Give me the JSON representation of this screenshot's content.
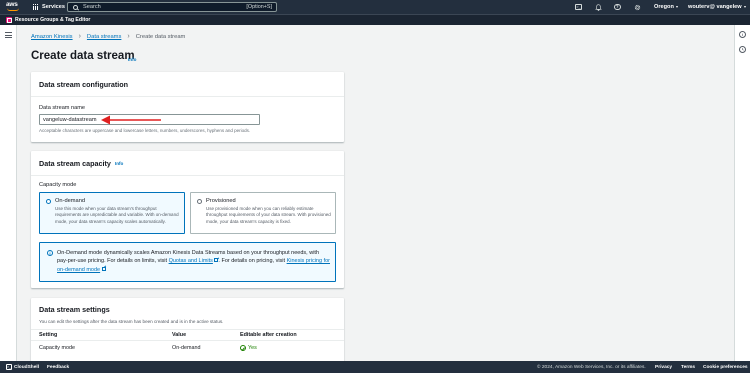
{
  "topnav": {
    "logo_text": "aws",
    "services_label": "Services",
    "search_placeholder": "Search",
    "search_shortcut": "[Option+S]",
    "region": "Oregon",
    "account": "wouterv@ vangelew",
    "icons": [
      "cloudshell-icon",
      "bell-icon",
      "help-icon",
      "gear-icon"
    ]
  },
  "subnav": {
    "label": "Resource Groups & Tag Editor"
  },
  "breadcrumb": {
    "items": [
      "Amazon Kinesis",
      "Data streams"
    ],
    "current": "Create data stream"
  },
  "page": {
    "title": "Create data stream",
    "info": "Info"
  },
  "config_panel": {
    "title": "Data stream configuration",
    "name_label": "Data stream name",
    "name_value": "vangeluw-datastream",
    "constraint": "Acceptable characters are uppercase and lowercase letters, numbers, underscores, hyphens and periods."
  },
  "capacity_panel": {
    "title": "Data stream capacity",
    "info": "Info",
    "mode_label": "Capacity mode",
    "options": [
      {
        "title": "On-demand",
        "desc": "Use this mode when your data stream's throughput requirements are unpredictable and variable. With on-demand mode, your data stream's capacity scales automatically.",
        "selected": true
      },
      {
        "title": "Provisioned",
        "desc": "Use provisioned mode when you can reliably estimate throughput requirements of your data stream. With provisioned mode, your data stream's capacity is fixed.",
        "selected": false
      }
    ],
    "alert": {
      "text1": "On-Demand mode dynamically scales Amazon Kinesis Data Streams based on your throughput needs, with pay-per-use pricing. For details on limits, visit ",
      "link1": "Quotas and Limits",
      "text2": ". For details on pricing, visit ",
      "link2": "Kinesis pricing for on-demand mode"
    }
  },
  "settings_panel": {
    "title": "Data stream settings",
    "desc": "You can edit the settings after the data stream has been created and is in the active status.",
    "columns": [
      "Setting",
      "Value",
      "Editable after creation"
    ],
    "rows": [
      {
        "setting": "Capacity mode",
        "value": "On-demand",
        "editable": "Yes"
      }
    ]
  },
  "footer": {
    "cloudshell": "CloudShell",
    "feedback": "Feedback",
    "copyright": "© 2024, Amazon Web Services, Inc. or its affiliates.",
    "privacy": "Privacy",
    "terms": "Terms",
    "cookies": "Cookie preferences"
  },
  "colors": {
    "nav": "#232f3e",
    "link": "#0073bb",
    "annotation": "#e02020",
    "success": "#1d8102"
  }
}
